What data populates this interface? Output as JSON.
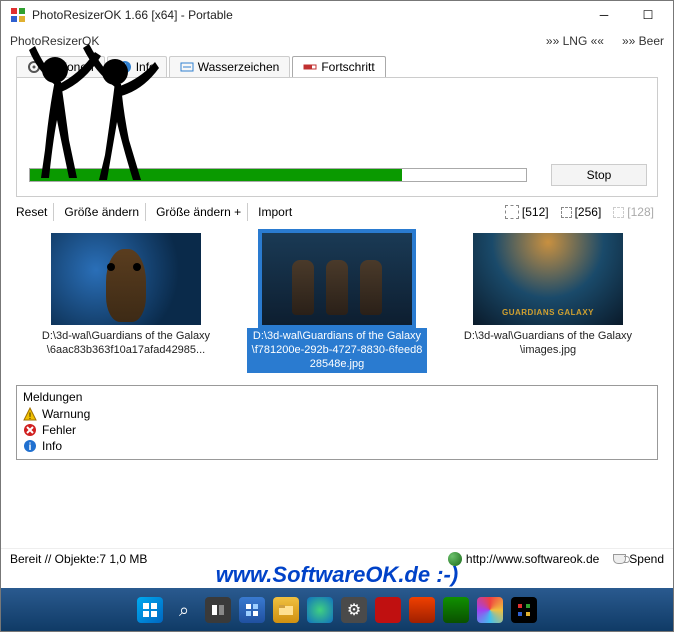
{
  "titlebar": {
    "title": "PhotoResizerOK 1.66 [x64] - Portable"
  },
  "approw": {
    "appname": "PhotoResizerOK",
    "lng": "»» LNG ««",
    "beer": "»» Beer"
  },
  "tabs": {
    "options": "Optionen",
    "info": "Info",
    "watermark": "Wasserzeichen",
    "progress": "Fortschritt"
  },
  "progress": {
    "stop": "Stop"
  },
  "toolbar": {
    "reset": "Reset",
    "resize": "Größe ändern",
    "resize_plus": "Größe ändern +",
    "import": "Import",
    "s512": "[512]",
    "s256": "[256]",
    "s128": "[128]"
  },
  "thumbs": [
    {
      "caption": "D:\\3d-wal\\Guardians of the Galaxy\\6aac83b363f10a17afad42985...",
      "selected": false,
      "kind": "groot"
    },
    {
      "caption": "D:\\3d-wal\\Guardians of the Galaxy\\f781200e-292b-4727-8830-6feed828548e.jpg",
      "selected": true,
      "kind": "people"
    },
    {
      "caption": "D:\\3d-wal\\Guardians of the Galaxy\\images.jpg",
      "selected": false,
      "kind": "poster"
    }
  ],
  "messages": {
    "header": "Meldungen",
    "warning": "Warnung",
    "error": "Fehler",
    "info": "Info"
  },
  "status": {
    "ready": "Bereit // Objekte:7 1,0 MB",
    "url": "http://www.softwareok.de",
    "spend": "Spend"
  },
  "watermark": "www.SoftwareOK.de :-)",
  "poster_title": "GUARDIANS GALAXY"
}
